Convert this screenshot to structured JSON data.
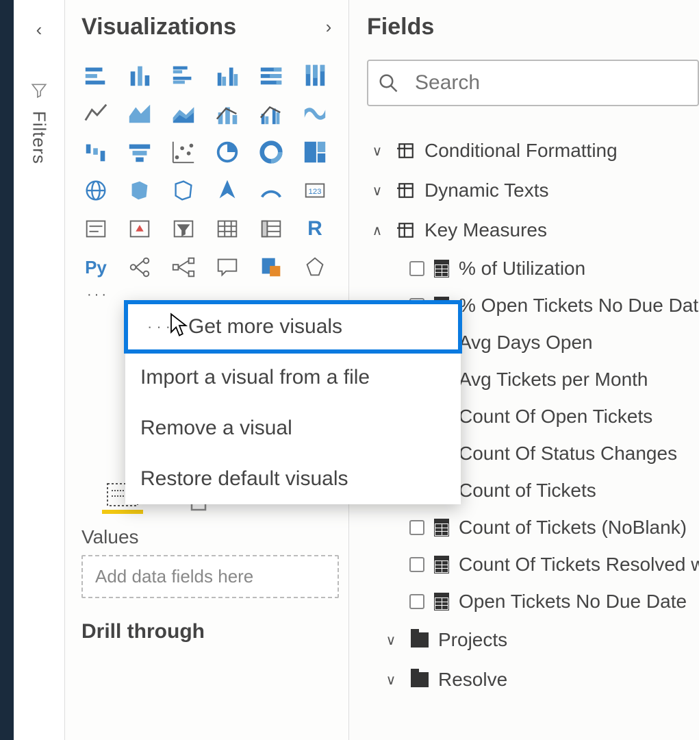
{
  "filters": {
    "label": "Filters"
  },
  "viz": {
    "title": "Visualizations",
    "context_menu": {
      "get_more": "Get more visuals",
      "import": "Import a visual from a file",
      "remove": "Remove a visual",
      "restore": "Restore default visuals"
    },
    "py": "Py",
    "r": "R",
    "values_label": "Values",
    "drop_hint": "Add data fields here",
    "drill_label": "Drill through"
  },
  "fields": {
    "title": "Fields",
    "search_placeholder": "Search",
    "tables": {
      "conditional": "Conditional Formatting",
      "dynamic": "Dynamic Texts",
      "key_measures": "Key Measures",
      "projects": "Projects",
      "resolve": "Resolve"
    },
    "measures": {
      "m0": "% of Utilization",
      "m1": "% Open Tickets No Due Date",
      "m2": "Avg Days Open",
      "m3": "Avg Tickets per Month",
      "m4": "Count Of Open Tickets",
      "m5": "Count Of Status Changes",
      "m6": "Count of Tickets",
      "m7": "Count of Tickets (NoBlank)",
      "m8": "Count Of Tickets Resolved wit",
      "m9": "Open Tickets No Due Date"
    }
  }
}
